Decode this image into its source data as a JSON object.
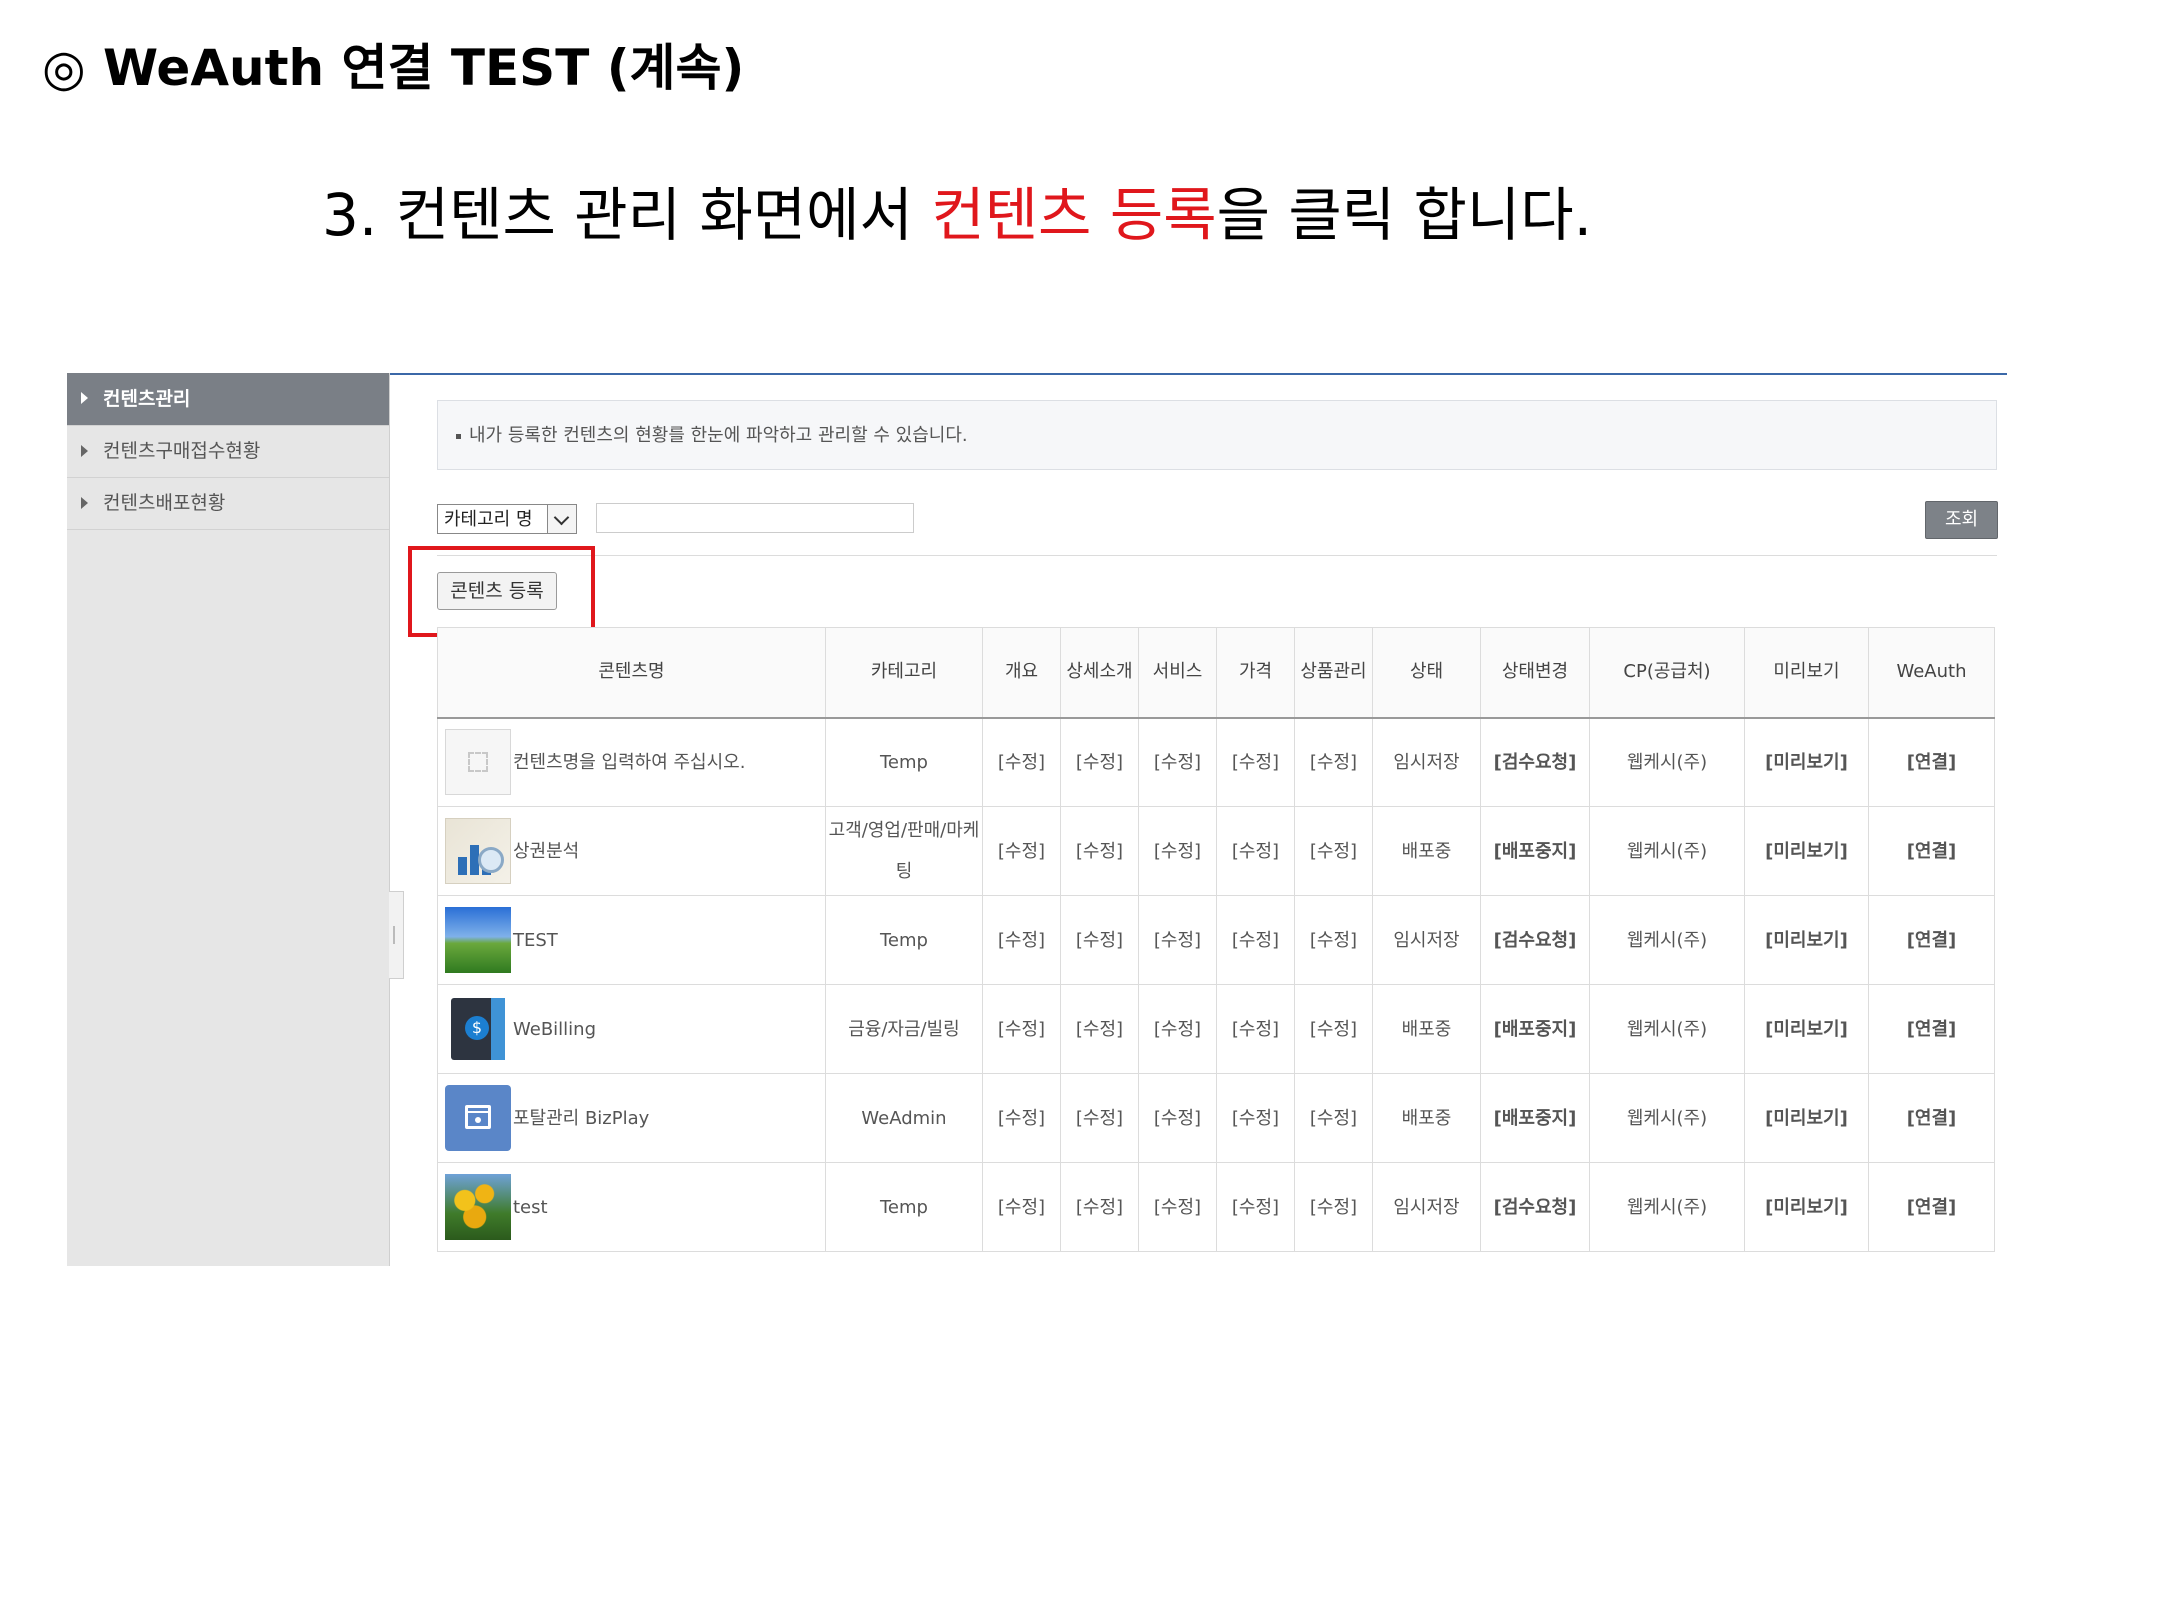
{
  "slide": {
    "title": "◎ WeAuth 연결 TEST (계속)",
    "instruction_before": "3. 컨텐츠 관리 화면에서 ",
    "instruction_highlight": "컨텐츠 등록",
    "instruction_after": "을 클릭 합니다.",
    "highlight_color": "#e0171c"
  },
  "sidebar": {
    "items": [
      {
        "label": "컨텐츠관리",
        "active": true
      },
      {
        "label": "컨텐츠구매접수현황",
        "active": false
      },
      {
        "label": "컨텐츠배포현황",
        "active": false
      }
    ]
  },
  "notice": "내가 등록한 컨텐츠의 현황를 한눈에 파악하고 관리할 수 있습니다.",
  "search": {
    "category_selected": "카테고리 명",
    "input_value": "",
    "button_label": "조회"
  },
  "register_button_label": "콘텐츠 등록",
  "table": {
    "headers": [
      "콘텐츠명",
      "카테고리",
      "개요",
      "상세소개",
      "서비스",
      "가격",
      "상품관리",
      "상태",
      "상태변경",
      "CP(공급처)",
      "미리보기",
      "WeAuth"
    ],
    "rows": [
      {
        "thumb": "placeholder-icon",
        "name": "컨텐츠명을 입력하여 주십시오.",
        "category": "Temp",
        "overview": "[수정]",
        "detail": "[수정]",
        "service": "[수정]",
        "price": "[수정]",
        "product": "[수정]",
        "status": "임시저장",
        "status_change": "[검수요청]",
        "cp": "웹케시(주)",
        "preview": "[미리보기]",
        "weauth": "[연결]"
      },
      {
        "thumb": "chart-magnifier-icon",
        "name": "상권분석",
        "category": "고객/영업/판매/마케팅",
        "overview": "[수정]",
        "detail": "[수정]",
        "service": "[수정]",
        "price": "[수정]",
        "product": "[수정]",
        "status": "배포중",
        "status_change": "[배포중지]",
        "cp": "웹케시(주)",
        "preview": "[미리보기]",
        "weauth": "[연결]"
      },
      {
        "thumb": "landscape-image",
        "name": "TEST",
        "category": "Temp",
        "overview": "[수정]",
        "detail": "[수정]",
        "service": "[수정]",
        "price": "[수정]",
        "product": "[수정]",
        "status": "임시저장",
        "status_change": "[검수요청]",
        "cp": "웹케시(주)",
        "preview": "[미리보기]",
        "weauth": "[연결]"
      },
      {
        "thumb": "billing-book-icon",
        "name": "WeBilling",
        "category": "금융/자금/빌링",
        "overview": "[수정]",
        "detail": "[수정]",
        "service": "[수정]",
        "price": "[수정]",
        "product": "[수정]",
        "status": "배포중",
        "status_change": "[배포중지]",
        "cp": "웹케시(주)",
        "preview": "[미리보기]",
        "weauth": "[연결]"
      },
      {
        "thumb": "admin-window-icon",
        "name": "포탈관리 BizPlay",
        "category": "WeAdmin",
        "overview": "[수정]",
        "detail": "[수정]",
        "service": "[수정]",
        "price": "[수정]",
        "product": "[수정]",
        "status": "배포중",
        "status_change": "[배포중지]",
        "cp": "웹케시(주)",
        "preview": "[미리보기]",
        "weauth": "[연결]"
      },
      {
        "thumb": "tulips-image",
        "name": "test",
        "category": "Temp",
        "overview": "[수정]",
        "detail": "[수정]",
        "service": "[수정]",
        "price": "[수정]",
        "product": "[수정]",
        "status": "임시저장",
        "status_change": "[검수요청]",
        "cp": "웹케시(주)",
        "preview": "[미리보기]",
        "weauth": "[연결]"
      }
    ]
  },
  "colors": {
    "link": "#1533b8",
    "sidebar_active": "#7a7f86",
    "header_line": "#3b68a8"
  }
}
